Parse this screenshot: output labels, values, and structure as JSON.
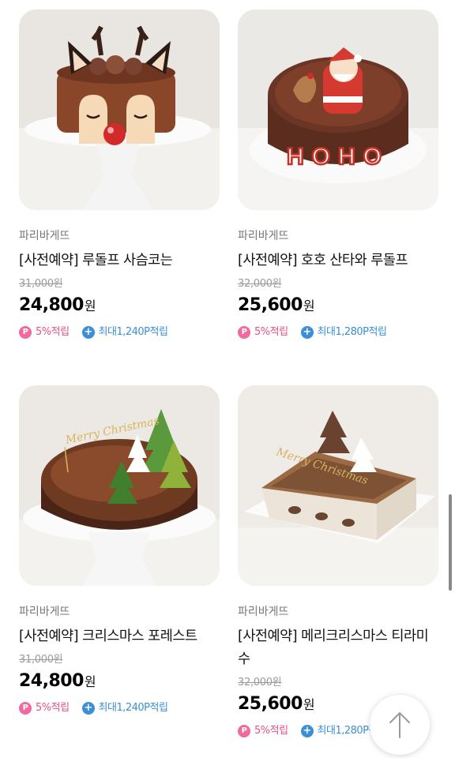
{
  "products": [
    {
      "brand": "파리바게뜨",
      "name": "[사전예약] 루돌프 사슴코는",
      "original_price": "31,000원",
      "price": "24,800",
      "currency": "원",
      "point_rate": "5%적립",
      "max_points": "최대1,240P적립"
    },
    {
      "brand": "파리바게뜨",
      "name": "[사전예약] 호호 산타와 루돌프",
      "original_price": "32,000원",
      "price": "25,600",
      "currency": "원",
      "point_rate": "5%적립",
      "max_points": "최대1,280P적립",
      "cake_lettering": "HOHO"
    },
    {
      "brand": "파리바게뜨",
      "name": "[사전예약] 크리스마스 포레스트",
      "original_price": "31,000원",
      "price": "24,800",
      "currency": "원",
      "point_rate": "5%적립",
      "max_points": "최대1,240P적립",
      "cake_lettering": "Merry Christmas"
    },
    {
      "brand": "파리바게뜨",
      "name": "[사전예약] 메리크리스마스 티라미수",
      "original_price": "32,000원",
      "price": "25,600",
      "currency": "원",
      "point_rate": "5%적립",
      "max_points": "최대1,280P적립",
      "cake_lettering": "Merry Christmas"
    }
  ],
  "badges": {
    "point_icon_glyph": "P",
    "plus_icon_glyph": "+"
  },
  "colors": {
    "point_pink": "#e8527f",
    "plus_blue": "#3a8fd6",
    "price_black": "#000000"
  }
}
